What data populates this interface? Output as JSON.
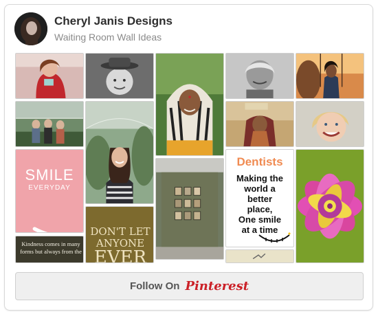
{
  "header": {
    "owner_name": "Cheryl Janis Designs",
    "board_name": "Waiting Room Wall Ideas"
  },
  "tiles": {
    "smile": {
      "title": "SMILE",
      "subtitle": "EVERYDAY"
    },
    "dont_let": {
      "line1": "DON'T LET",
      "line2": "ANYONE",
      "line3": "EVER"
    },
    "kindness": {
      "text": "Kindness comes in many forms but always from the"
    },
    "dentists": {
      "title": "Dentists",
      "line1": "Making the",
      "line2": "world a",
      "line3": "better",
      "line4": "place,",
      "line5": "One smile",
      "line6": "at a time"
    }
  },
  "footer": {
    "follow_label": "Follow On",
    "brand": "Pinterest"
  },
  "colors": {
    "brand_red": "#cb2027",
    "smile_pink": "#f0a4aa",
    "dentist_orange": "#f08b52"
  }
}
